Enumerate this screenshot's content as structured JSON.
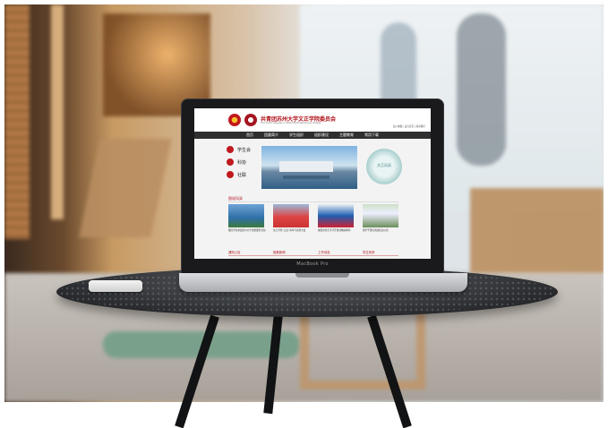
{
  "scene": {
    "laptop_model_label": "MacBook Pro"
  },
  "website": {
    "title": "共青团苏州大学文正学院委员会",
    "subtitle": "The Youth Leagues in SOOCHOW Wenzheng College",
    "top_links": "加入收藏 | 设为首页 | 联系我们",
    "nav": [
      "首页",
      "团委简介",
      "学生组织",
      "组织建设",
      "主题教育",
      "常用下载"
    ],
    "left_badges": [
      "学生会",
      "科协",
      "社联"
    ],
    "circle_text": "文正风采",
    "section_title": "图说风采",
    "captions": [
      "我院学生参加苏州大学志愿服务活动",
      "文正学院“五四”青年节表彰大会",
      "校园文化艺术节开幕式精彩瞬间",
      "团学干部培训班结业仪式"
    ],
    "bottom_sections": [
      "通知公告",
      "团委新闻",
      "工作动态",
      "学生风采"
    ]
  },
  "colors": {
    "site_accent": "#b0121b",
    "nav_bar": "#2f2f31"
  }
}
